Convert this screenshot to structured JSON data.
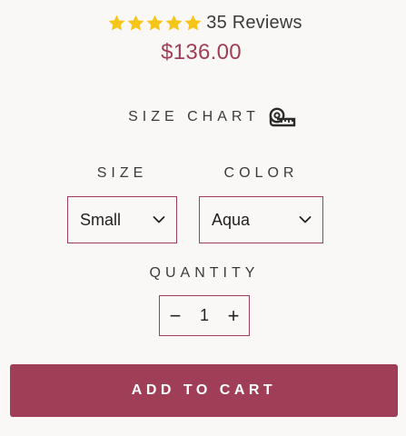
{
  "rating": {
    "stars": 5,
    "reviews_label": "35 Reviews",
    "star_color": "#f5c518"
  },
  "price": "$136.00",
  "size_chart": {
    "label": "SIZE CHART",
    "icon": "measuring-tape-icon"
  },
  "options": {
    "size": {
      "label": "SIZE",
      "selected": "Small"
    },
    "color": {
      "label": "COLOR",
      "selected": "Aqua"
    }
  },
  "quantity": {
    "label": "QUANTITY",
    "decrement": "−",
    "value": "1",
    "increment": "+"
  },
  "cart_button": {
    "label": "ADD TO CART"
  },
  "colors": {
    "accent": "#a13e57",
    "background": "#faf8f6"
  }
}
